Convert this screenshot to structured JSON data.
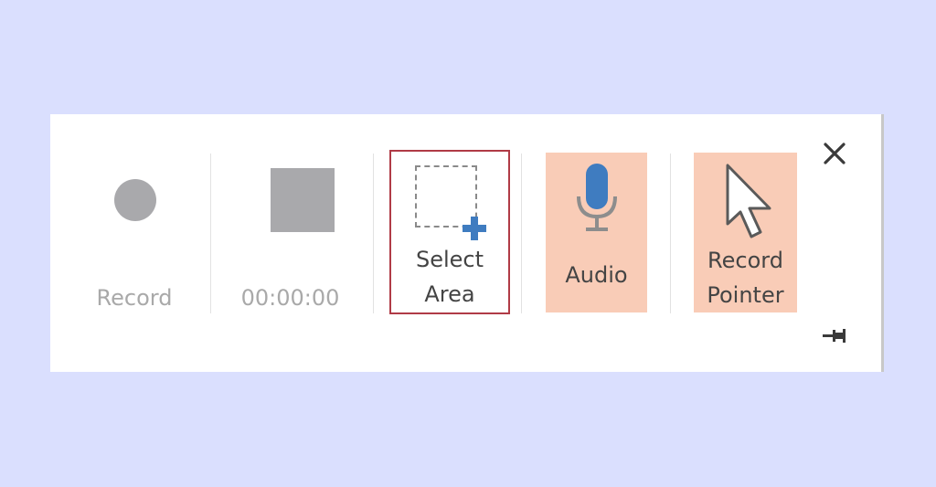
{
  "toolbar": {
    "record": {
      "label": "Record",
      "icon": "record-dot-icon",
      "enabled": false
    },
    "stop": {
      "label": "00:00:00",
      "icon": "stop-square-icon",
      "enabled": false
    },
    "select_area": {
      "label_line1": "Select",
      "label_line2": "Area",
      "icon": "dashed-rectangle-plus-icon",
      "selected": true
    },
    "audio": {
      "label": "Audio",
      "icon": "microphone-icon",
      "toggled": true
    },
    "record_pointer": {
      "label_line1": "Record",
      "label_line2": "Pointer",
      "icon": "mouse-pointer-icon",
      "toggled": true
    },
    "close": {
      "icon": "close-icon"
    },
    "pin": {
      "icon": "pin-icon"
    }
  },
  "colors": {
    "background": "#dadffe",
    "toolbar": "#ffffff",
    "disabled": "#a9a9ac",
    "toggle_highlight": "#f9ccb7",
    "select_border": "#b03b46",
    "accent_blue": "#3f7cc0"
  }
}
